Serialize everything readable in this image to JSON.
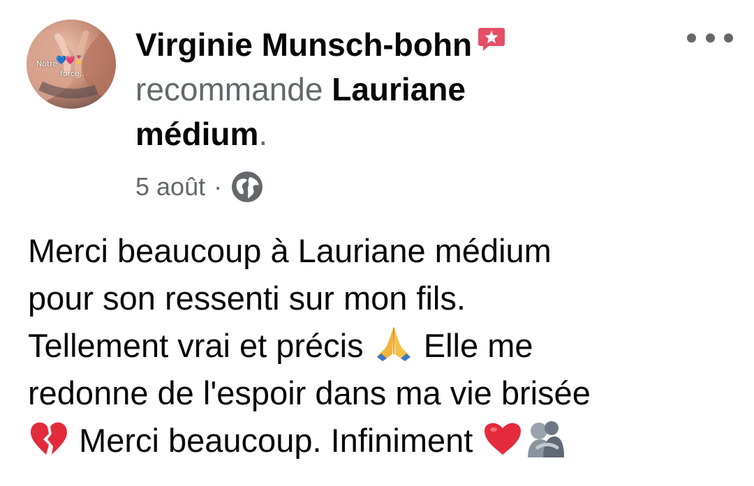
{
  "post": {
    "author": {
      "name": "Virginie Munsch-bohn",
      "avatar_text_1": "Notre",
      "avatar_text_2": "force..",
      "avatar_emojis": "💙💗🎖️",
      "badge_icon": "recommendation-star-icon",
      "badge_color": "#e64d67"
    },
    "action": {
      "verb": "recommande",
      "page_name_line1": "Lauriane",
      "page_name_line2": "médium",
      "end_punct": "."
    },
    "meta": {
      "date": "5 août",
      "separator": "·",
      "audience_icon": "globe-icon"
    },
    "more_icon": "more-options-icon",
    "body": {
      "line1": "Merci beaucoup à Lauriane médium",
      "line2": "pour son ressenti sur mon fils.",
      "line3_before": "Tellement vrai et précis",
      "line3_after": "Elle me",
      "line4": "redonne de l'espoir dans ma vie brisée",
      "line5_text": "Merci beaucoup. Infiniment",
      "emoji_pray": "praying-hands-emoji",
      "emoji_broken_heart": "broken-heart-emoji",
      "emoji_heart": "red-heart-emoji",
      "emoji_hug": "people-hugging-emoji"
    },
    "colors": {
      "text": "#050505",
      "secondary": "#65676b",
      "heart_red": "#e32b3c"
    }
  }
}
